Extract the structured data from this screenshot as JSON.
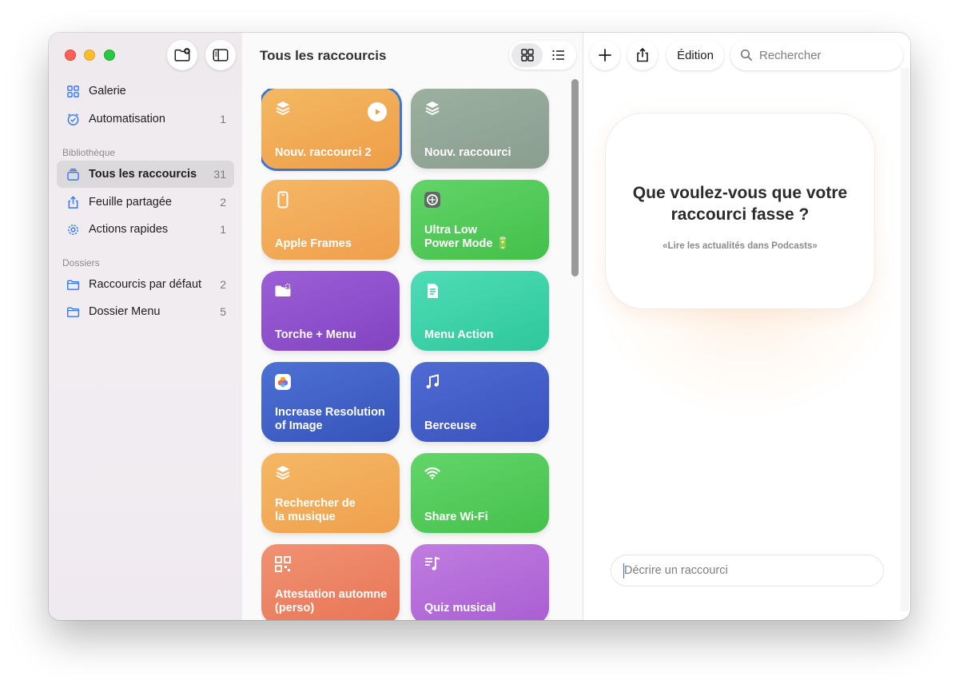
{
  "window": {
    "controls": [
      "close",
      "minimize",
      "zoom"
    ]
  },
  "toolbar": {
    "new_folder_icon": "folder-plus-icon",
    "sidebar_toggle_icon": "sidebar-icon"
  },
  "sidebar": {
    "top_items": [
      {
        "label": "Galerie",
        "icon": "grid-icon",
        "count": ""
      },
      {
        "label": "Automatisation",
        "icon": "clock-check-icon",
        "count": "1"
      }
    ],
    "library_header": "Bibliothèque",
    "library_items": [
      {
        "label": "Tous les raccourcis",
        "icon": "stack-icon",
        "count": "31",
        "selected": true
      },
      {
        "label": "Feuille partagée",
        "icon": "share-icon",
        "count": "2"
      },
      {
        "label": "Actions rapides",
        "icon": "gear-icon",
        "count": "1"
      }
    ],
    "folders_header": "Dossiers",
    "folder_items": [
      {
        "label": "Raccourcis par défaut",
        "icon": "folder-icon",
        "count": "2"
      },
      {
        "label": "Dossier Menu",
        "icon": "folder-icon",
        "count": "5"
      }
    ]
  },
  "main": {
    "title": "Tous les raccourcis",
    "view_modes": [
      "grid-view-icon",
      "list-view-icon"
    ],
    "shortcuts": [
      {
        "label": "Nouv. raccourci 2",
        "icon": "layers-icon",
        "color": "#f0a64e",
        "selected": true,
        "play": true
      },
      {
        "label": "Nouv. raccourci",
        "icon": "layers-icon",
        "color": "#8fa394"
      },
      {
        "label": "Apple Frames",
        "icon": "phone-icon",
        "color": "#f2a752"
      },
      {
        "label": "Ultra Low\nPower Mode 🔋",
        "icon": "app-icon",
        "color": "#4fc856"
      },
      {
        "label": "Torche + Menu",
        "icon": "folder-gear-icon",
        "color": "#8d4fc9"
      },
      {
        "label": "Menu Action",
        "icon": "document-icon",
        "color": "#34cfa6"
      },
      {
        "label": "Increase Resolution\nof Image",
        "icon": "photos-icon",
        "color": "#3f62c6"
      },
      {
        "label": "Berceuse",
        "icon": "music-note-icon",
        "color": "#4159c4"
      },
      {
        "label": "Rechercher de\nla musique",
        "icon": "layers-icon",
        "color": "#f1a851"
      },
      {
        "label": "Share Wi-Fi",
        "icon": "wifi-icon",
        "color": "#50c955"
      },
      {
        "label": "Attestation automne\n(perso)",
        "icon": "qr-code-icon",
        "color": "#ec8263"
      },
      {
        "label": "Quiz musical",
        "icon": "music-list-icon",
        "color": "#b56ad9"
      }
    ]
  },
  "right": {
    "add_icon": "plus-icon",
    "share_icon": "share-icon",
    "edit_label": "Édition",
    "search_placeholder": "Rechercher",
    "prompt_title": "Que voulez-vous que votre raccourci fasse ?",
    "prompt_example": "«Lire les actualités dans Podcasts»",
    "describe_placeholder": "Décrire un raccourci"
  },
  "colors": {
    "accent": "#3a76d8",
    "sidebar_bg": "#eeeaed",
    "selected_row": "#dcd9dd"
  }
}
